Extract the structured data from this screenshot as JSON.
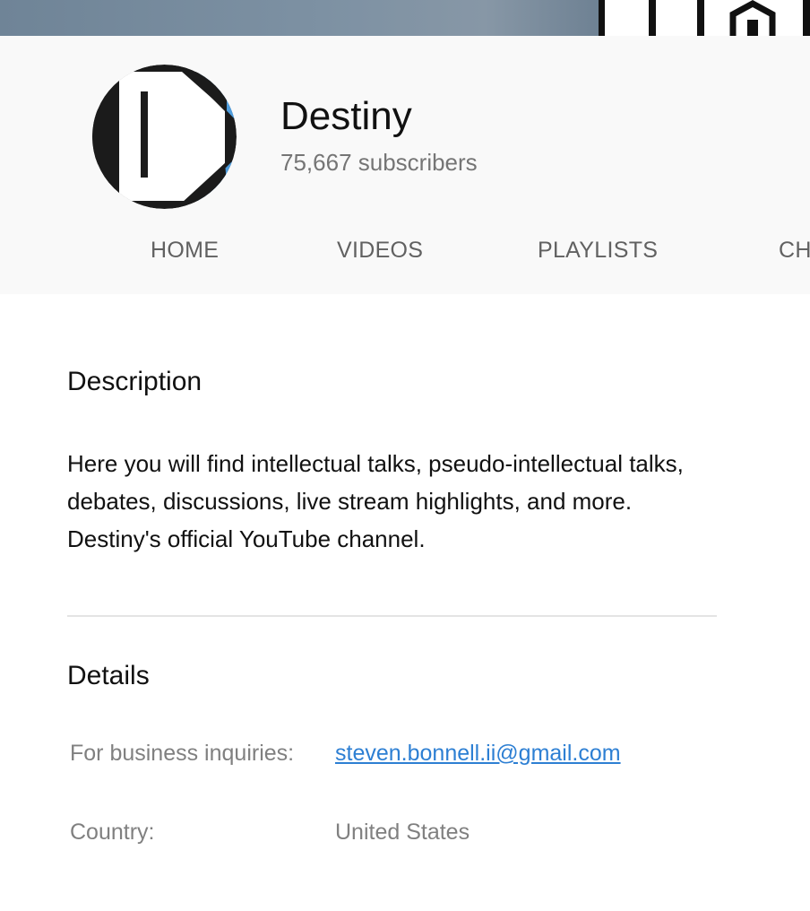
{
  "channel": {
    "name": "Destiny",
    "subscribers": "75,667 subscribers"
  },
  "tabs": [
    {
      "label": "HOME"
    },
    {
      "label": "VIDEOS"
    },
    {
      "label": "PLAYLISTS"
    },
    {
      "label": "CH"
    }
  ],
  "description": {
    "heading": "Description",
    "text": "Here you will find intellectual talks, pseudo-intellectual talks, debates, discussions, live stream highlights, and more. Destiny's official YouTube channel."
  },
  "details": {
    "heading": "Details",
    "business_label": "For business inquiries:",
    "business_email": "steven.bonnell.ii@gmail.com",
    "country_label": "Country:",
    "country_value": "United States"
  },
  "colors": {
    "link": "#2d7fd3",
    "avatar_accent": "#4f9ddd",
    "header_bg": "#f9f9f9"
  }
}
